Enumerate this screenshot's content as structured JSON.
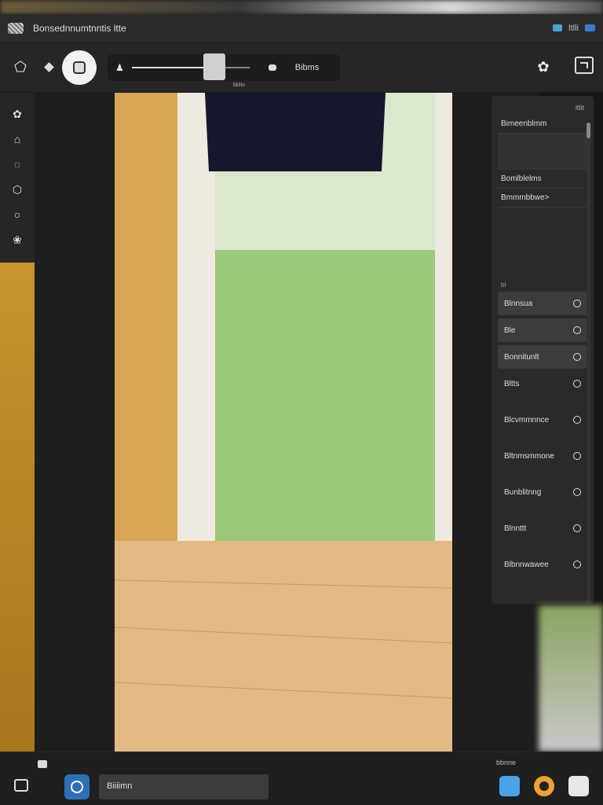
{
  "titlebar": {
    "title": "Bonsednnumtnntis ltte",
    "status_text": "ltlli"
  },
  "toolbar": {
    "slider_label": "Bibms",
    "slider_value": "bblto",
    "slider_position": 0.62
  },
  "panel": {
    "header": "ltlit",
    "fields": [
      "Bimeenblmm",
      "Bomlblelms",
      "Bmmmbbwe>"
    ],
    "section_label": "bl",
    "items": [
      {
        "label": "Blnnsua",
        "active": true
      },
      {
        "label": "Ble",
        "active": true
      },
      {
        "label": "Bonnitunlt",
        "active": true
      },
      {
        "label": "Bltts",
        "active": false
      },
      {
        "label": "Blcvmmnnce",
        "active": false
      },
      {
        "label": "Bltnmsmmone",
        "active": false
      },
      {
        "label": "Bunblitnng",
        "active": false
      },
      {
        "label": "Blnnttt",
        "active": false
      },
      {
        "label": "Blbnnwawee",
        "active": false
      }
    ]
  },
  "bottombar": {
    "field_text": "Biiiimn",
    "label": "bbnne"
  },
  "colors": {
    "accent_blue": "#2c6fb8",
    "accent_orange": "#f0a030",
    "panel_bg": "#2a2a2a"
  }
}
